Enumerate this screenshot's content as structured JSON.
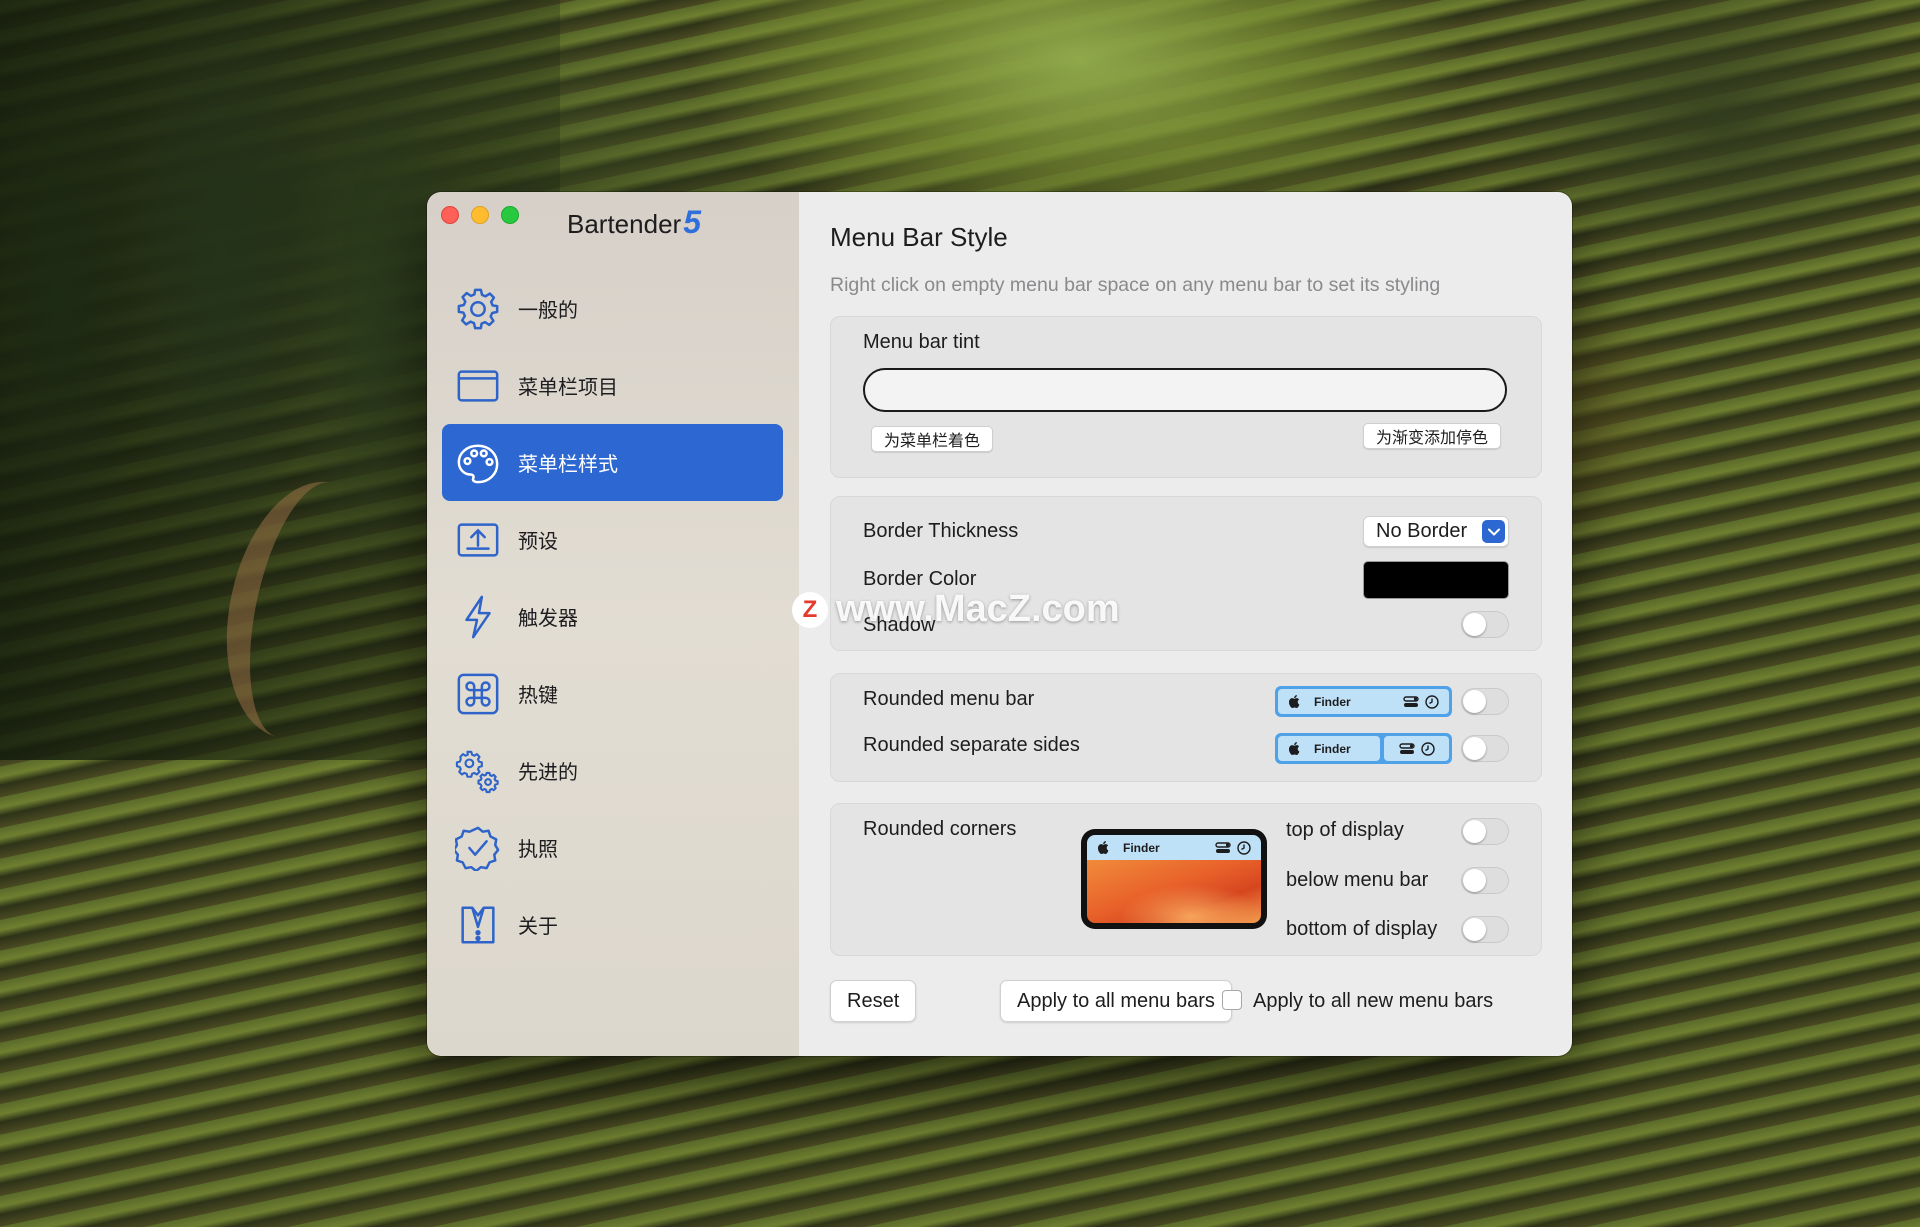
{
  "app": {
    "name": "Bartender",
    "version_mark": "5"
  },
  "sidebar": {
    "items": [
      {
        "label": "一般的",
        "icon": "gear-icon",
        "active": false
      },
      {
        "label": "菜单栏项目",
        "icon": "menu-bar-window-icon",
        "active": false
      },
      {
        "label": "菜单栏样式",
        "icon": "palette-icon",
        "active": true
      },
      {
        "label": "预设",
        "icon": "preset-upload-icon",
        "active": false
      },
      {
        "label": "触发器",
        "icon": "lightning-bolt-icon",
        "active": false
      },
      {
        "label": "热键",
        "icon": "command-key-icon",
        "active": false
      },
      {
        "label": "先进的",
        "icon": "gears-icon",
        "active": false
      },
      {
        "label": "执照",
        "icon": "license-badge-icon",
        "active": false
      },
      {
        "label": "关于",
        "icon": "bartender-vest-icon",
        "active": false
      }
    ]
  },
  "main": {
    "title": "Menu Bar Style",
    "subtitle": "Right click on empty menu bar space on any menu bar to set its styling",
    "tint": {
      "label": "Menu bar tint",
      "tint_button": "为菜单栏着色",
      "gradient_button": "为渐变添加停色"
    },
    "border": {
      "thickness_label": "Border Thickness",
      "thickness_value": "No Border",
      "color_label": "Border Color",
      "color_value": "#000000",
      "shadow_label": "Shadow",
      "shadow_on": false
    },
    "rounded": {
      "menu_bar_label": "Rounded menu bar",
      "separate_sides_label": "Rounded separate sides",
      "preview_app": "Finder",
      "menu_bar_on": false,
      "separate_sides_on": false
    },
    "corners": {
      "label": "Rounded corners",
      "preview_app": "Finder",
      "top_label": "top of display",
      "below_label": "below menu bar",
      "bottom_label": "bottom of display",
      "top_on": false,
      "below_on": false,
      "bottom_on": false
    },
    "footer": {
      "reset_label": "Reset",
      "apply_all_label": "Apply to all menu bars",
      "apply_new_label": "Apply to all new menu bars",
      "apply_new_checked": false
    }
  },
  "watermark": {
    "badge": "Z",
    "text": "www.MacZ.com"
  },
  "colors": {
    "accent": "#2d67d1",
    "close": "#fe5f57",
    "minimize": "#febc2e",
    "maximize": "#28c840"
  }
}
